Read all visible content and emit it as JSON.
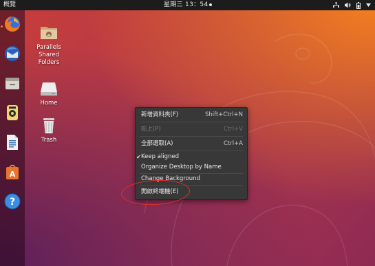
{
  "topbar": {
    "activities_label": "概覽",
    "clock": "星期三 13：54",
    "tray_icons": [
      "network-icon",
      "volume-icon",
      "battery-icon",
      "chevron-down-icon"
    ]
  },
  "dock": {
    "items": [
      {
        "name": "firefox-icon"
      },
      {
        "name": "thunderbird-icon"
      },
      {
        "name": "files-icon"
      },
      {
        "name": "rhythmbox-icon"
      },
      {
        "name": "libreoffice-writer-icon"
      },
      {
        "name": "software-center-icon"
      },
      {
        "name": "help-icon"
      }
    ]
  },
  "desktop_icons": [
    {
      "name": "parallels-shared-folders",
      "label": "Parallels\nShared\nFolders",
      "icon": "folder-share-icon"
    },
    {
      "name": "home",
      "label": "Home",
      "icon": "drive-icon"
    },
    {
      "name": "trash",
      "label": "Trash",
      "icon": "trash-icon"
    }
  ],
  "context_menu": {
    "items": [
      {
        "label": "新增資料夾(F)",
        "accel": "Shift+Ctrl+N",
        "enabled": true
      },
      {
        "label": "貼上(P)",
        "accel": "Ctrl+V",
        "enabled": false
      },
      {
        "label": "全部選取(A)",
        "accel": "Ctrl+A",
        "enabled": true
      },
      {
        "label": "Keep aligned",
        "checked": true,
        "enabled": true
      },
      {
        "label": "Organize Desktop by Name",
        "enabled": true
      },
      {
        "label": "Change Background",
        "enabled": true
      },
      {
        "label": "開啟終端機(E)",
        "enabled": true
      }
    ]
  },
  "colors": {
    "annotation": "#e0302a",
    "topbar_bg": "#1c1c1c",
    "menu_bg": "#383838"
  }
}
